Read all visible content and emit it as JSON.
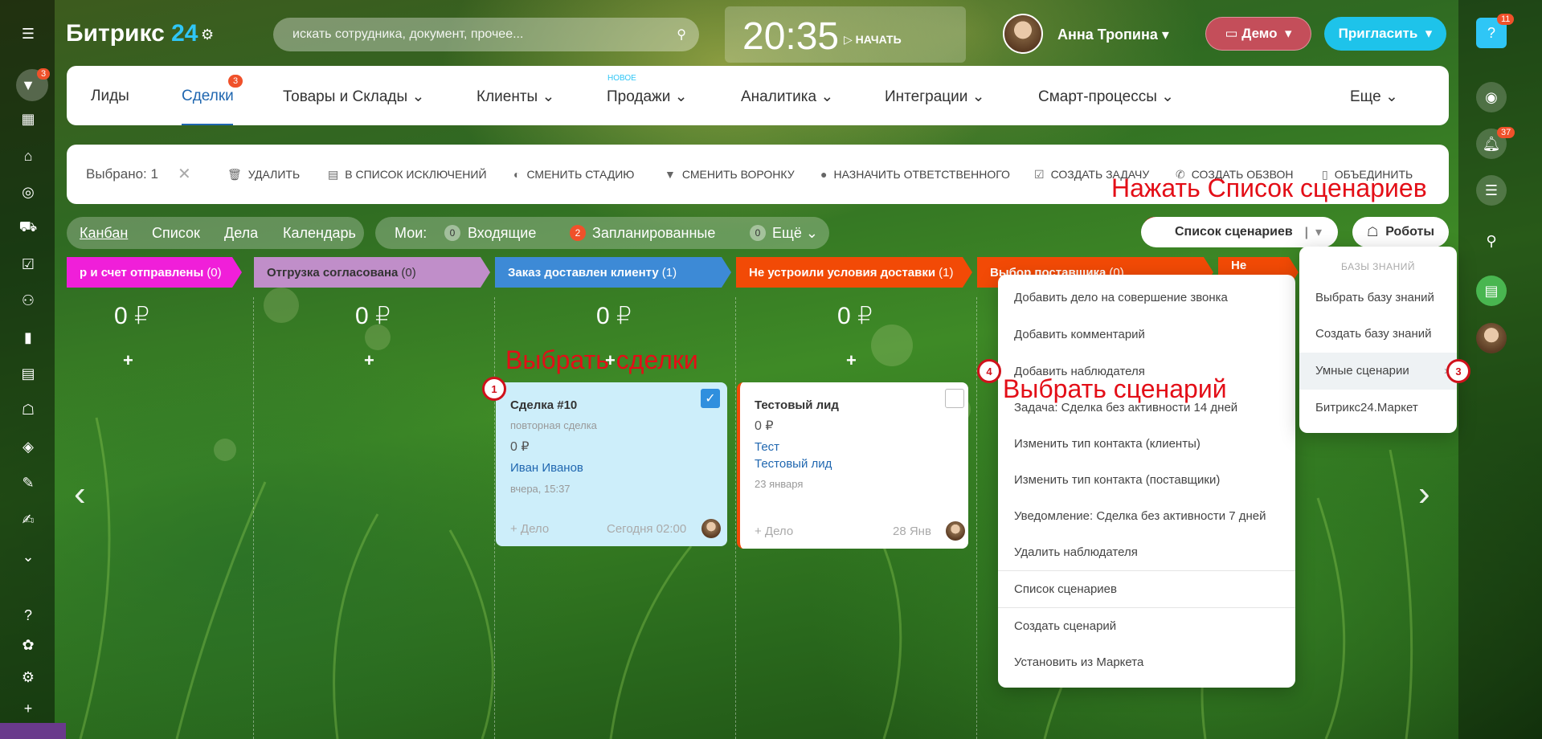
{
  "brand": {
    "name": "Битрикс",
    "num": "24"
  },
  "search": {
    "placeholder": "искать сотрудника, документ, прочее..."
  },
  "clock": {
    "time": "20:35",
    "start_label": "НАЧАТЬ"
  },
  "user": {
    "name": "Анна Тропина"
  },
  "header_buttons": {
    "demo": "Демо",
    "invite": "Пригласить"
  },
  "left_rail": {
    "badge": "3"
  },
  "right_rail": {
    "help_badge": "11",
    "notif_badge": "37"
  },
  "nav": {
    "items": [
      "Лиды",
      "Сделки",
      "Товары и Склады",
      "Клиенты",
      "Продажи",
      "Аналитика",
      "Интеграции",
      "Смарт-процессы",
      "Еще"
    ],
    "deals_badge": "3",
    "new_label": "НОВОЕ"
  },
  "actions": {
    "selected": "Выбрано: 1",
    "items": [
      "УДАЛИТЬ",
      "В СПИСОК ИСКЛЮЧЕНИЙ",
      "СМЕНИТЬ СТАДИЮ",
      "СМЕНИТЬ ВОРОНКУ",
      "НАЗНАЧИТЬ ОТВЕТСТВЕННОГО",
      "СОЗДАТЬ ЗАДАЧУ",
      "СОЗДАТЬ ОБЗВОН",
      "ОБЪЕДИНИТЬ"
    ]
  },
  "annotations": {
    "press_list": "Нажать Список сценариев",
    "select_deals": "Выбрать сделки",
    "select_scenario": "Выбрать сценарий",
    "m1": "1",
    "m2": "2",
    "m3": "3",
    "m4": "4"
  },
  "views": [
    "Канбан",
    "Список",
    "Дела",
    "Календарь"
  ],
  "filters": {
    "mine": "Мои:",
    "incoming": "Входящие",
    "incoming_count": "0",
    "planned": "Запланированные",
    "planned_count": "2",
    "more": "Ещё",
    "more_count": "0"
  },
  "scenario_button": "Список сценариев",
  "robots_button": "Роботы",
  "columns": [
    {
      "title": "р и счет отправлены",
      "count": "(0)",
      "color": "#f01fd9",
      "sum": "0 ₽"
    },
    {
      "title": "Отгрузка согласована",
      "count": "(0)",
      "color": "#c08ec9",
      "sum": "0 ₽"
    },
    {
      "title": "Заказ доставлен клиенту",
      "count": "(1)",
      "color": "#3d8ad6",
      "sum": "0 ₽"
    },
    {
      "title": "Не устроили условия доставки",
      "count": "(1)",
      "color": "#f24a06",
      "sum": "0 ₽"
    },
    {
      "title": "Выбор поставщика",
      "count": "(0)",
      "color": "#f24a06",
      "sum": ""
    },
    {
      "title": "Не устроила",
      "count": "",
      "color": "#f24a06",
      "sum": ""
    }
  ],
  "cards": {
    "deal": {
      "title": "Сделка #10",
      "sub": "повторная сделка",
      "sum": "0 ₽",
      "contact": "Иван Иванов",
      "date": "вчера, 15:37",
      "add": "+ Дело",
      "due": "Сегодня 02:00"
    },
    "lead": {
      "title": "Тестовый лид",
      "sum": "0 ₽",
      "link1": "Тест",
      "link2": "Тестовый лид",
      "date": "23 января",
      "add": "+ Дело",
      "due": "28 Янв"
    }
  },
  "scenario_menu": [
    "Добавить дело на совершение звонка",
    "Добавить комментарий",
    "Добавить наблюдателя",
    "Задача: Сделка без активности 14 дней",
    "Изменить тип контакта (клиенты)",
    "Изменить тип контакта (поставщики)",
    "Уведомление: Сделка без активности 7 дней",
    "Удалить наблюдателя",
    "Список сценариев",
    "Создать сценарий",
    "Установить из Маркета"
  ],
  "kb_menu": {
    "header": "БАЗЫ ЗНАНИЙ",
    "items": [
      "Выбрать базу знаний",
      "Создать базу знаний",
      "Умные сценарии",
      "Битрикс24.Маркет"
    ]
  }
}
